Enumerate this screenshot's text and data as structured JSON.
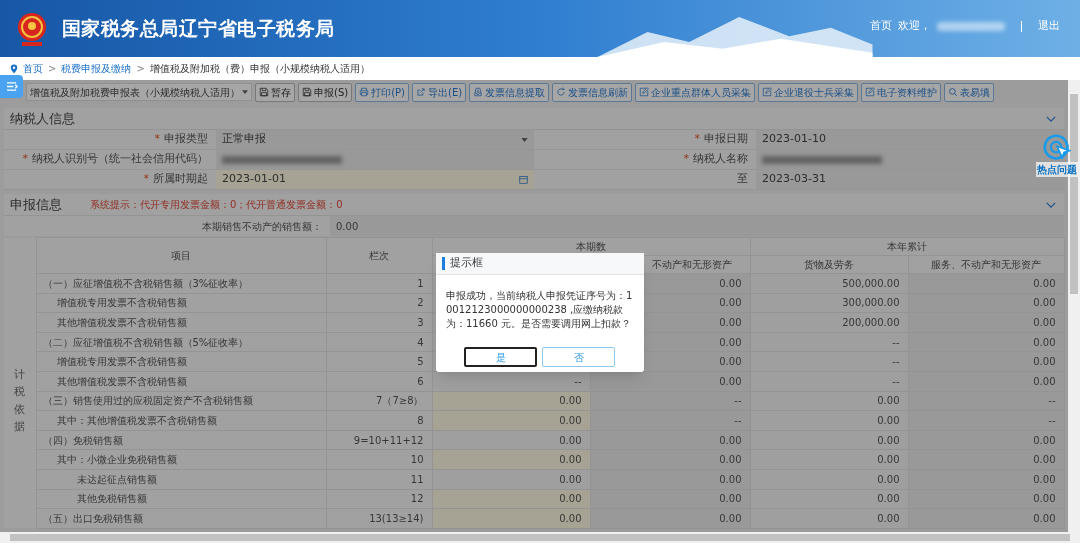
{
  "header": {
    "title": "国家税务总局辽宁省电子税务局",
    "nav": [
      {
        "kind": "link",
        "label": "首页"
      },
      {
        "kind": "link",
        "label": "欢迎，"
      },
      {
        "kind": "blurred"
      },
      {
        "kind": "link",
        "label": "退出"
      }
    ]
  },
  "breadcrumb": {
    "separator": ">",
    "items": [
      {
        "label": "首页",
        "link": true
      },
      {
        "label": "税费申报及缴纳",
        "link": true
      },
      {
        "label": "增值税及附加税（费）申报（小规模纳税人适用）",
        "link": false
      }
    ]
  },
  "toolbar": {
    "form_select": "增值税及附加税费申报表（小规模纳税人适用）",
    "buttons": [
      {
        "label": "暂存",
        "kind": "save"
      },
      {
        "label": "申报(S)",
        "kind": "save"
      },
      {
        "label": "打印(P)",
        "kind": "print"
      },
      {
        "label": "导出(E)",
        "kind": "export"
      },
      {
        "label": "发票信息提取",
        "kind": "tray"
      },
      {
        "label": "发票信息刷新",
        "kind": "refresh"
      },
      {
        "label": "企业重点群体人员采集",
        "kind": "edit"
      },
      {
        "label": "企业退役士兵采集",
        "kind": "edit"
      },
      {
        "label": "电子资料维护",
        "kind": "edit"
      },
      {
        "label": "表易填",
        "kind": "search"
      }
    ]
  },
  "taxpayer_info": {
    "title": "纳税人信息",
    "fields": [
      {
        "required_mark": "*",
        "label": "申报类型",
        "kind": "select",
        "value": "正常申报"
      },
      {
        "required_mark": "*",
        "label": "申报日期",
        "kind": "text",
        "value": "2023-01-10"
      },
      {
        "required_mark": "*",
        "label": "纳税人识别号（统一社会信用代码）",
        "kind": "blurred"
      },
      {
        "required_mark": "*",
        "label": "纳税人名称",
        "kind": "blurred"
      },
      {
        "required_mark": "*",
        "label": "所属时期起",
        "kind": "date",
        "value": "2023-01-01"
      },
      {
        "label": "至",
        "kind": "text",
        "value": "2023-03-31"
      }
    ]
  },
  "declaration_info": {
    "title": "申报信息",
    "notice": "系统提示：代开专用发票金额：0；代开普通发票金额：0",
    "property_sales": {
      "label": "本期销售不动产的销售额：",
      "value": "0.00"
    },
    "table": {
      "group_label": "计税依据",
      "item_header": "项目",
      "line_header": "栏次",
      "groups": [
        {
          "label": "本期数",
          "subcolumns": {
            "property": "不动产和无形资产"
          }
        },
        {
          "label": "本年累计",
          "subcolumns": {
            "goods": "货物及劳务",
            "property": "服务、不动产和无形资产"
          }
        }
      ],
      "rows": [
        {
          "item": "（一）应征增值税不含税销售额（3%征收率）",
          "line": "1",
          "current_property": "0.00",
          "ytd_goods": "500,000.00",
          "ytd_property": "0.00",
          "children": [
            {
              "item": "增值税专用发票不含税销售额",
              "line": "2",
              "current_property": "0.00",
              "ytd_goods": "300,000.00",
              "ytd_property": "0.00"
            },
            {
              "item": "其他增值税发票不含税销售额",
              "line": "3",
              "current_property": "0.00",
              "ytd_goods": "200,000.00",
              "ytd_property": "0.00"
            }
          ]
        },
        {
          "item": "（二）应征增值税不含税销售额（5%征收率）",
          "line": "4",
          "current_property": "0.00",
          "ytd_goods": "--",
          "ytd_property": "0.00",
          "children": [
            {
              "item": "增值税专用发票不含税销售额",
              "line": "5",
              "current_property": "0.00",
              "ytd_goods": "--",
              "ytd_property": "0.00"
            },
            {
              "item": "其他增值税发票不含税销售额",
              "line": "6",
              "current_goods": "--",
              "current_property": "0.00",
              "ytd_goods": "--",
              "ytd_property": "0.00"
            }
          ]
        },
        {
          "item": "（三）销售使用过的应税固定资产不含税销售额",
          "line": "7（7≥8）",
          "editable": true,
          "current_goods": "0.00",
          "current_property": "--",
          "ytd_goods": "0.00",
          "ytd_property": "--",
          "children": [
            {
              "item": "其中：其他增值税发票不含税销售额",
              "line": "8",
              "editable": true,
              "current_goods": "0.00",
              "current_property": "--",
              "ytd_goods": "0.00",
              "ytd_property": "--"
            }
          ]
        },
        {
          "item": "（四）免税销售额",
          "line": "9=10+11+12",
          "editable": false,
          "current_goods": "0.00",
          "current_property": "0.00",
          "ytd_goods": "0.00",
          "ytd_property": "0.00",
          "children": [
            {
              "item": "其中：小微企业免税销售额",
              "line": "10",
              "editable": true,
              "current_goods": "0.00",
              "current_property": "0.00",
              "ytd_goods": "0.00",
              "ytd_property": "0.00",
              "children": [
                {
                  "item": "未达起征点销售额",
                  "line": "11",
                  "editable": false,
                  "current_goods": "0.00",
                  "current_property": "0.00",
                  "ytd_goods": "0.00",
                  "ytd_property": "0.00"
                },
                {
                  "item": "其他免税销售额",
                  "line": "12",
                  "editable": true,
                  "current_goods": "0.00",
                  "current_property": "0.00",
                  "ytd_goods": "0.00",
                  "ytd_property": "0.00"
                }
              ]
            }
          ]
        },
        {
          "item": "（五）出口免税销售额",
          "line": "13(13≥14)",
          "editable": true,
          "current_goods": "0.00",
          "current_property": "0.00",
          "ytd_goods": "0.00",
          "ytd_property": "0.00"
        }
      ]
    }
  },
  "help_widget": {
    "label": "热点问题"
  },
  "dialog": {
    "title": "提示框",
    "message": "申报成功，当前纳税人申报凭证序号为：10012123000000000238 ,应缴纳税款为：11660 元。是否需要调用网上扣款？",
    "buttons": [
      {
        "label": "是",
        "focused": true
      },
      {
        "label": "否",
        "focused": false
      }
    ]
  }
}
